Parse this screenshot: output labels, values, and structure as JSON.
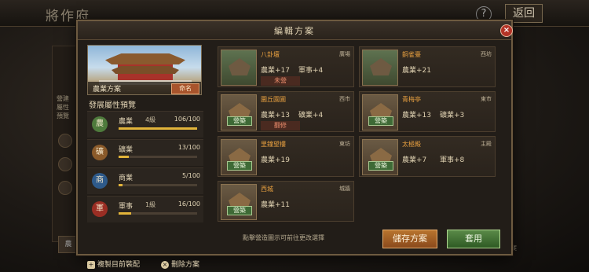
{
  "background": {
    "title": "將作府",
    "help_label": "?",
    "back_label": "返回",
    "side_text": "營建 屬性 預覽",
    "side_icons": [
      "農",
      "礦",
      "商",
      "軍"
    ],
    "right_tags": [
      "頂級",
      "西坊",
      "主殿"
    ],
    "footer_text": "方案"
  },
  "dialog": {
    "title": "編輯方案",
    "close_label": "×"
  },
  "preview": {
    "label": "農業方案",
    "rename_label": "命名"
  },
  "section_title": "發展屬性預覽",
  "stats": [
    {
      "icon": "農",
      "name": "農業",
      "level": "4級",
      "value": "106/100",
      "fill": 1.0,
      "color": "#4e7a3c"
    },
    {
      "icon": "礦",
      "name": "礦業",
      "level": "",
      "value": "13/100",
      "fill": 0.13,
      "color": "#8a5a2a"
    },
    {
      "icon": "商",
      "name": "商業",
      "level": "",
      "value": "5/100",
      "fill": 0.05,
      "color": "#2e5a8a"
    },
    {
      "icon": "軍",
      "name": "軍事",
      "level": "1級",
      "value": "16/100",
      "fill": 0.16,
      "color": "#9a2e24"
    }
  ],
  "actions": {
    "copy_label": "複製目前裝配",
    "delete_label": "刪除方案"
  },
  "buildings": [
    {
      "name": "八卦壇",
      "loc": "廣場",
      "b1": "農業+17",
      "b2": "軍事+4",
      "tag": "未營",
      "under_construction": false
    },
    {
      "name": "圜丘園圃",
      "loc": "西市",
      "b1": "農業+13",
      "b2": "礦業+4",
      "tag": "翻修",
      "under_construction": true
    },
    {
      "name": "里鐘望樓",
      "loc": "東坊",
      "b1": "農業+19",
      "b2": "",
      "tag": "",
      "under_construction": true
    },
    {
      "name": "西城",
      "loc": "城牆",
      "b1": "農業+11",
      "b2": "",
      "tag": "",
      "under_construction": true
    },
    {
      "name": "銅雀臺",
      "loc": "西坊",
      "b1": "農業+21",
      "b2": "",
      "tag": "",
      "under_construction": false
    },
    {
      "name": "青梅亭",
      "loc": "東市",
      "b1": "農業+13",
      "b2": "礦業+3",
      "tag": "",
      "under_construction": true
    },
    {
      "name": "太極殿",
      "loc": "主殿",
      "b1": "農業+7",
      "b2": "軍事+8",
      "tag": "",
      "under_construction": true
    }
  ],
  "build_badge": "營築",
  "hint": "點擊營造圖示可前往更改選擇",
  "save_label": "儲存方案",
  "apply_label": "套用"
}
